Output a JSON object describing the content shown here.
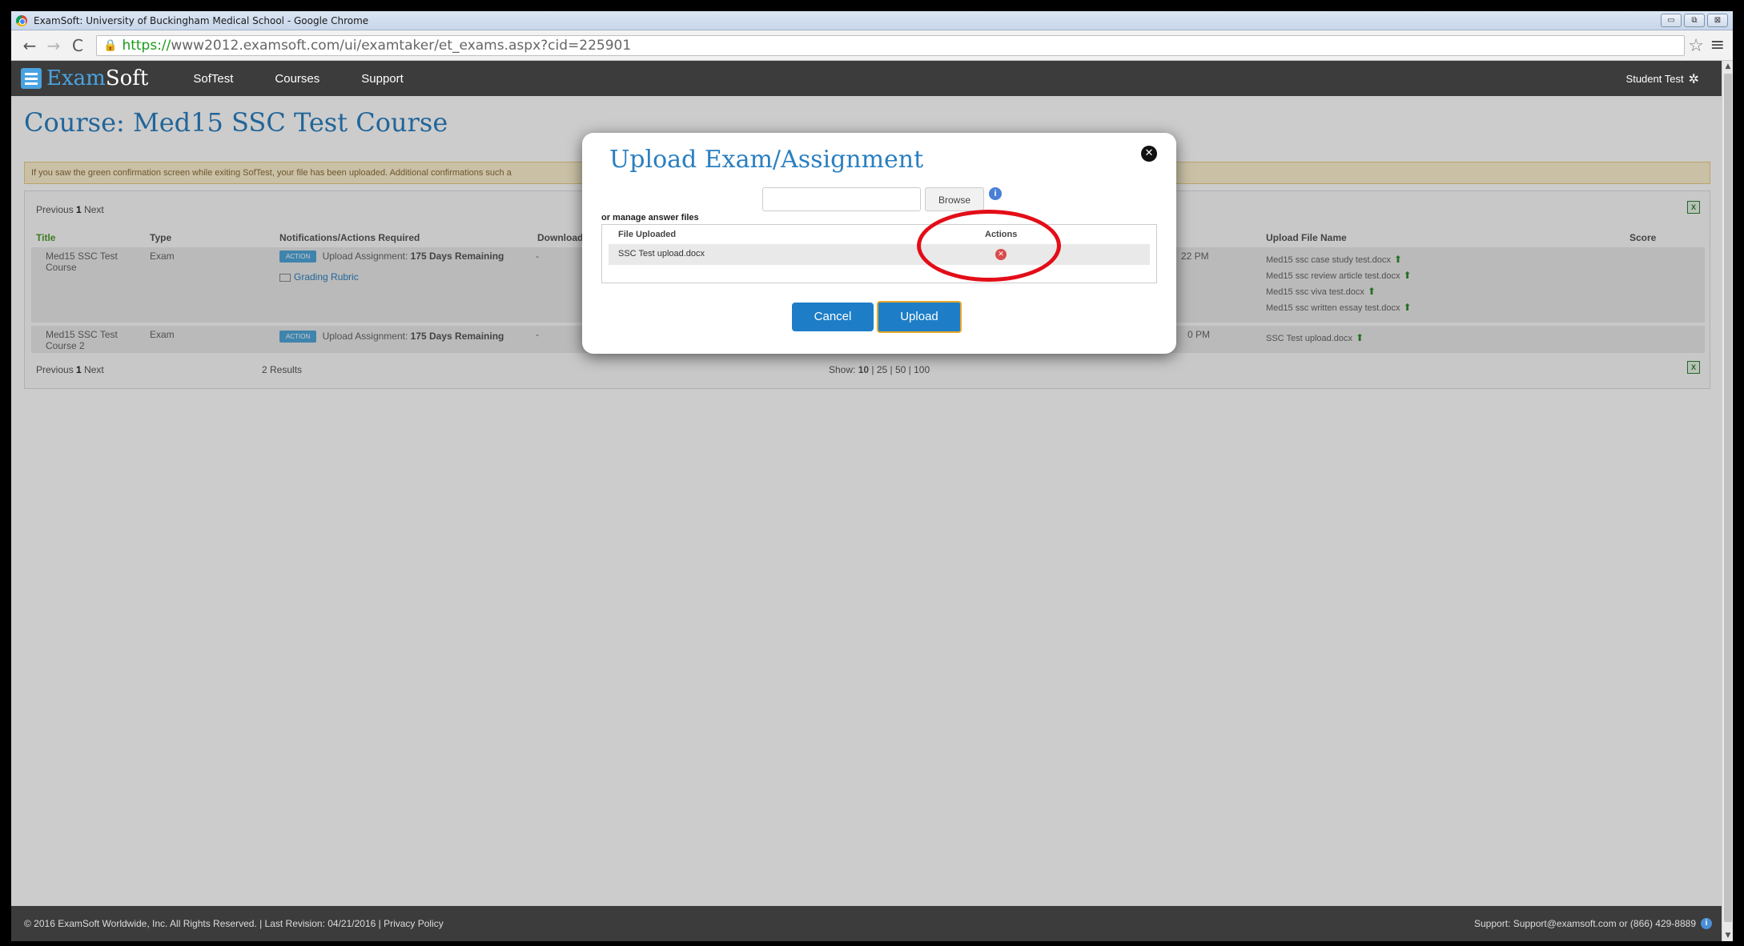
{
  "browser": {
    "window_title": "ExamSoft: University of Buckingham Medical School - Google Chrome",
    "url_https": "https://",
    "url_rest": "www2012.examsoft.com/ui/examtaker/et_exams.aspx?cid=225901",
    "back_icon": "←",
    "forward_icon": "→",
    "reload_icon": "C",
    "star_icon": "☆",
    "menu_icon": "≡",
    "minimize_icon": "▭",
    "restore_icon": "⧉",
    "close_icon": "⊠"
  },
  "nav": {
    "logo_exam": "Exam",
    "logo_soft": "Soft",
    "items": [
      "SofTest",
      "Courses",
      "Support"
    ],
    "user": "Student Test",
    "gear_icon": "✲"
  },
  "page": {
    "course_title": "Course: Med15 SSC Test Course",
    "notice": "If you saw the green confirmation screen while exiting SofTest, your file has been uploaded. Additional confirmations such a",
    "pager_prev": "Previous",
    "pager_num": "1",
    "pager_next": "Next",
    "xls_icon": "X",
    "columns": {
      "title": "Title",
      "type": "Type",
      "notifications": "Notifications/Actions Required",
      "download": "Download",
      "upload_file_name": "Upload File Name",
      "score": "Score"
    },
    "rows": [
      {
        "title": "Med15 SSC Test Course",
        "type": "Exam",
        "action_badge": "ACTION",
        "notification_prefix": "Upload Assignment:",
        "notification_bold": "175 Days Remaining",
        "rubric": "Grading Rubric",
        "download": "-",
        "time_partial": "22 PM",
        "files": [
          "Med15 ssc case study test.docx",
          "Med15 ssc review article test.docx",
          "Med15 ssc viva test.docx",
          "Med15 ssc written essay test.docx"
        ]
      },
      {
        "title": "Med15 SSC Test Course 2",
        "type": "Exam",
        "action_badge": "ACTION",
        "notification_prefix": "Upload Assignment:",
        "notification_bold": "175 Days Remaining",
        "download": "-",
        "time_partial": "0 PM",
        "files": [
          "SSC Test upload.docx"
        ]
      }
    ],
    "download_arrow": "⬆",
    "results": "2 Results",
    "show_prefix": "Show:",
    "show_current": "10",
    "show_rest": "| 25 | 50 | 100"
  },
  "modal": {
    "title": "Upload Exam/Assignment",
    "close_icon": "✕",
    "browse_label": "Browse",
    "info_icon": "i",
    "manage_label": "or manage answer files",
    "col_file": "File Uploaded",
    "col_actions": "Actions",
    "uploaded_file": "SSC Test upload.docx",
    "delete_icon": "✕",
    "cancel_label": "Cancel",
    "upload_label": "Upload"
  },
  "footer": {
    "left": "© 2016 ExamSoft Worldwide, Inc. All Rights Reserved. | Last Revision: 04/21/2016 | Privacy Policy",
    "right": "Support: Support@examsoft.com or (866) 429-8889",
    "info_icon": "i"
  },
  "colors": {
    "accent": "#2a7fc0",
    "nav_bg": "#3c3c3c",
    "highlight_ring": "#e30d18",
    "upload_border": "#e6a82b"
  }
}
